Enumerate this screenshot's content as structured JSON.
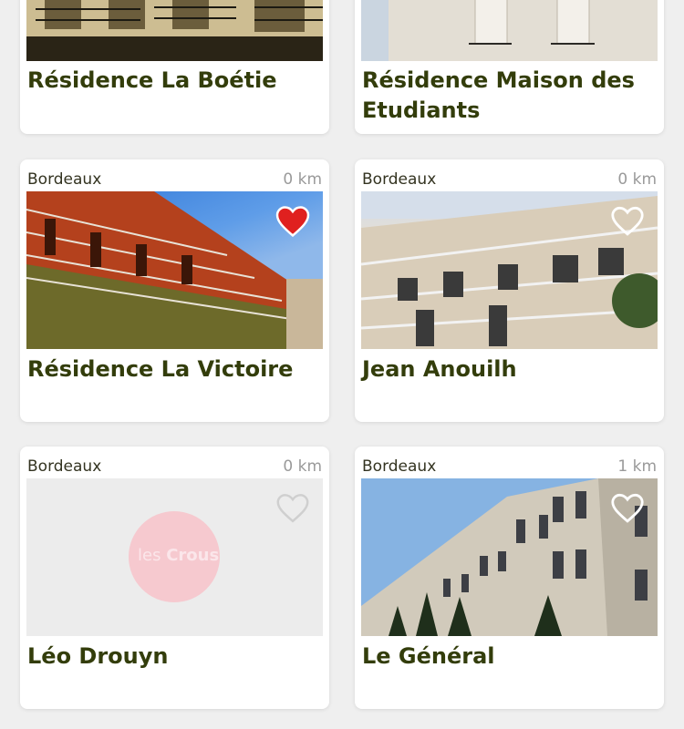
{
  "cards": [
    {
      "name": "Résidence La Boétie",
      "city": "",
      "distance": "",
      "favorite": false
    },
    {
      "name": "Résidence Maison des Etudiants",
      "city": "",
      "distance": "",
      "favorite": false
    },
    {
      "name": "Résidence La Victoire",
      "city": "Bordeaux",
      "distance": "0 km",
      "favorite": true
    },
    {
      "name": "Jean Anouilh",
      "city": "Bordeaux",
      "distance": "0 km",
      "favorite": false
    },
    {
      "name": "Léo Drouyn",
      "city": "Bordeaux",
      "distance": "0 km",
      "favorite": false,
      "placeholder_logo": {
        "text_light": "les ",
        "text_bold": "Crous"
      }
    },
    {
      "name": "Le Général",
      "city": "Bordeaux",
      "distance": "1 km",
      "favorite": false
    }
  ],
  "colors": {
    "title": "#333d0b",
    "favorite_heart": "#e0201f",
    "empty_heart_on_photo": "#ffffff",
    "empty_heart_on_placeholder": "#d0d0d0",
    "placeholder_logo": "#f6c9cf"
  },
  "icons": {
    "favorite": "heart-filled-icon",
    "not_favorite": "heart-outline-icon"
  }
}
